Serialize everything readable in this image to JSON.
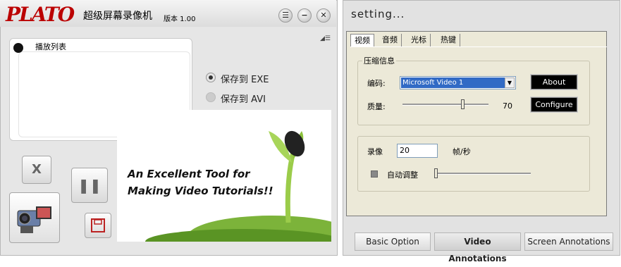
{
  "left": {
    "logo": "PLATO",
    "app_title": "超级屏幕录像机",
    "version": "版本 1.00",
    "playlist_label": "播放列表",
    "save_exe": "保存到 EXE",
    "save_avi": "保存到 AVI",
    "promo_line1": "An Excellent Tool for",
    "promo_line2": "Making Video Tutorials!!",
    "close_x": "X"
  },
  "right": {
    "title": "setting...",
    "tabs": [
      "视频",
      "音频",
      "光标",
      "热键"
    ],
    "group_compress": "压缩信息",
    "codec_label": "编码:",
    "codec_value": "Microsoft Video 1",
    "about_button": "About",
    "quality_label": "质量:",
    "quality_value": "70",
    "configure_button": "Configure",
    "record_label": "录像",
    "fps_value": "20",
    "fps_unit": "帧/秒",
    "auto_adjust": "自动调整",
    "bottom_tabs": [
      "Basic Option",
      "Video Annotations",
      "Screen Annotations"
    ]
  }
}
